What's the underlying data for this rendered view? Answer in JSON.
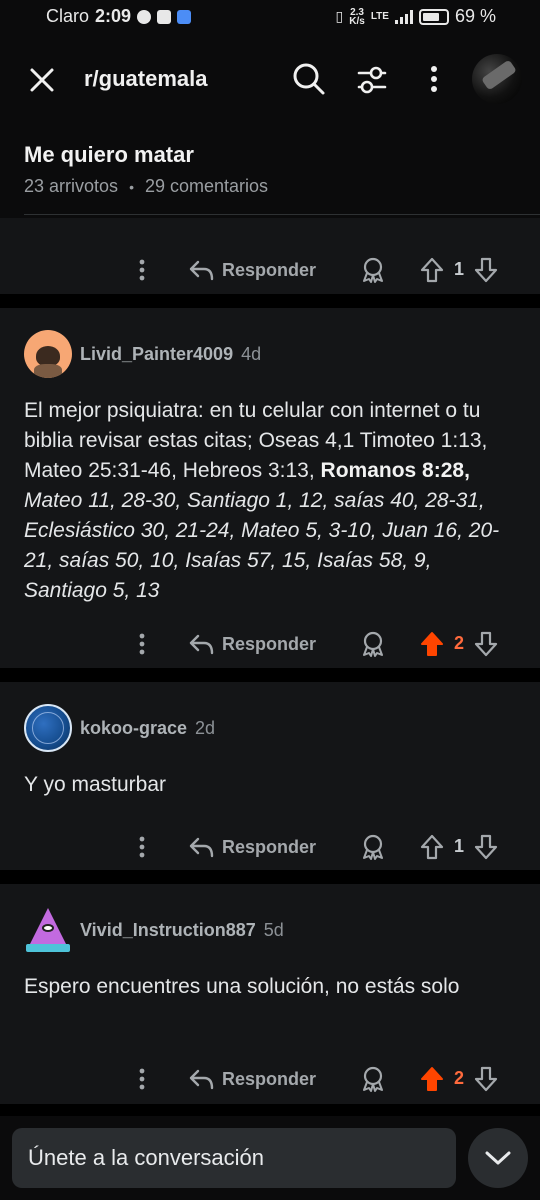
{
  "status_bar": {
    "carrier": "Claro",
    "time": "2:09",
    "net_speed_value": "2.3",
    "net_speed_unit": "K/s",
    "network_type": "LTE",
    "battery": "69 %"
  },
  "header": {
    "subreddit": "r/guatemala"
  },
  "post": {
    "title": "Me quiero matar",
    "upvotes": "23 arrivotos",
    "separator": "•",
    "comments": "29 comentarios"
  },
  "comments": [
    {
      "reply_label": "Responder",
      "votes": "1",
      "upvoted": false
    },
    {
      "username": "Livid_Painter4009",
      "age": "4d",
      "text_plain": "El mejor psiquiatra: en tu celular con internet o tu biblia revisar estas citas; Oseas 4,1 Timoteo 1:13, Mateo 25:31-46, Hebreos 3:13, ",
      "text_bold": "Romanos 8:28,",
      "text_italic": " Mateo 11, 28-30, Santiago 1, 12, saías 40, 28-31, Eclesiástico 30, 21-24, Mateo 5, 3-10, Juan 16, 20-21, saías 50, 10, Isaías 57, 15, Isaías 58, 9, Santiago 5, 13",
      "reply_label": "Responder",
      "votes": "2",
      "upvoted": true
    },
    {
      "username": "kokoo-grace",
      "age": "2d",
      "text": "Y yo masturbar",
      "reply_label": "Responder",
      "votes": "1",
      "upvoted": false
    },
    {
      "username": "Vivid_Instruction887",
      "age": "5d",
      "text": "Espero encuentres una solución, no estás solo",
      "reply_label": "Responder",
      "votes": "2",
      "upvoted": true
    }
  ],
  "bottom_bar": {
    "join_placeholder": "Únete a la conversación"
  },
  "colors": {
    "background": "#000000",
    "card": "#141517",
    "upvote_active": "#ff4500",
    "text_muted": "#9a9ea2"
  }
}
